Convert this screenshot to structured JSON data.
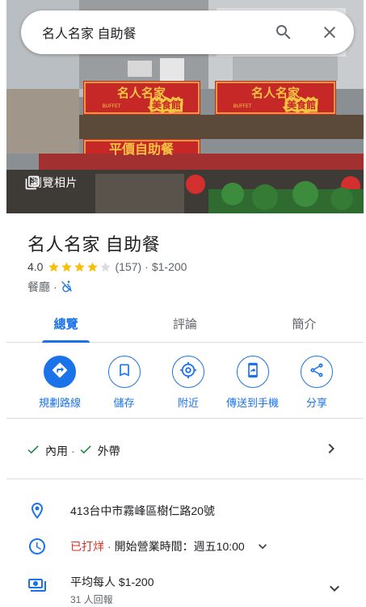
{
  "search": {
    "query": "名人名家 自助餐"
  },
  "hero": {
    "photo_button_label": "瀏覽相片",
    "sign_left_title": "名人名家",
    "sign_left_sub": "美食館",
    "sign_right_title": "名人名家",
    "sign_right_sub": "美食館",
    "sign_buffet": "BUFFET",
    "banner_text": "平價自助餐"
  },
  "place": {
    "name": "名人名家 自助餐",
    "rating_value": "4.0",
    "rating_stars": 4,
    "review_count": "(157)",
    "price_sep": "·",
    "price": "$1-200",
    "category": "餐廳",
    "category_sep": "·"
  },
  "tabs": [
    {
      "label": "總覽",
      "active": true
    },
    {
      "label": "評論",
      "active": false
    },
    {
      "label": "簡介",
      "active": false
    }
  ],
  "actions": [
    {
      "label": "規劃路線",
      "icon": "directions-icon"
    },
    {
      "label": "儲存",
      "icon": "bookmark-icon"
    },
    {
      "label": "附近",
      "icon": "nearby-icon"
    },
    {
      "label": "傳送到手機",
      "icon": "send-to-phone-icon"
    },
    {
      "label": "分享",
      "icon": "share-icon"
    }
  ],
  "service_options": {
    "dine_in": "內用",
    "separator": "·",
    "takeout": "外帶"
  },
  "info": {
    "address": "413台中市霧峰區樹仁路20號",
    "status": "已打烊",
    "hours_sep": "·",
    "hours_text": "開始營業時間：週五10:00",
    "price_per_person": "平均每人 $1-200",
    "price_reports": "31 人回報"
  },
  "colors": {
    "accent": "#1a73e8",
    "star": "#fbbc04",
    "closed": "#d93025",
    "check": "#188038"
  }
}
